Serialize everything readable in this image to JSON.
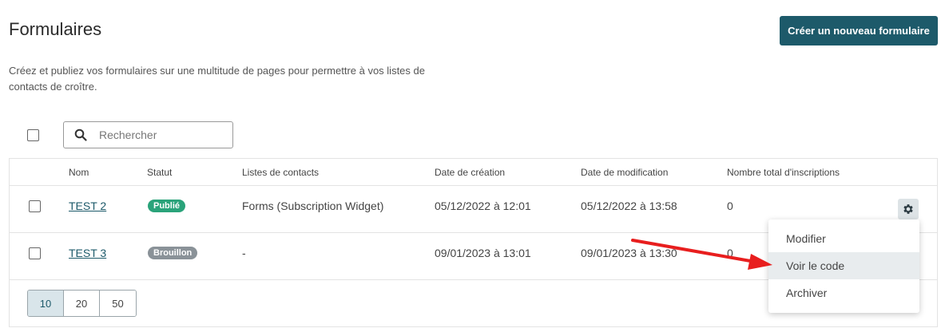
{
  "header": {
    "title": "Formulaires",
    "create_button": "Créer un nouveau formulaire",
    "description": "Créez et publiez vos formulaires sur une multitude de pages pour permettre à vos listes de contacts de croître."
  },
  "search": {
    "placeholder": "Rechercher"
  },
  "table": {
    "columns": [
      "Nom",
      "Statut",
      "Listes de contacts",
      "Date de création",
      "Date de modification",
      "Nombre total d'inscriptions"
    ],
    "rows": [
      {
        "name": "TEST 2",
        "status": "Publié",
        "lists": "Forms (Subscription Widget)",
        "created": "05/12/2022 à 12:01",
        "modified": "05/12/2022 à 13:58",
        "total": "0"
      },
      {
        "name": "TEST 3",
        "status": "Brouillon",
        "lists": "-",
        "created": "09/01/2023 à 13:01",
        "modified": "09/01/2023 à 13:30",
        "total": "0"
      }
    ]
  },
  "pagination": {
    "options": [
      "10",
      "20",
      "50"
    ],
    "selected": "10"
  },
  "context_menu": {
    "items": [
      "Modifier",
      "Voir le code",
      "Archiver"
    ],
    "highlighted": "Voir le code"
  },
  "icons": {
    "search": "search-icon",
    "settings": "gear-icon",
    "annotation": "red-arrow-icon"
  },
  "colors": {
    "primary": "#1d5a6a",
    "published": "#2aa37a",
    "draft": "#8a9298",
    "arrow": "#e81e1e"
  }
}
